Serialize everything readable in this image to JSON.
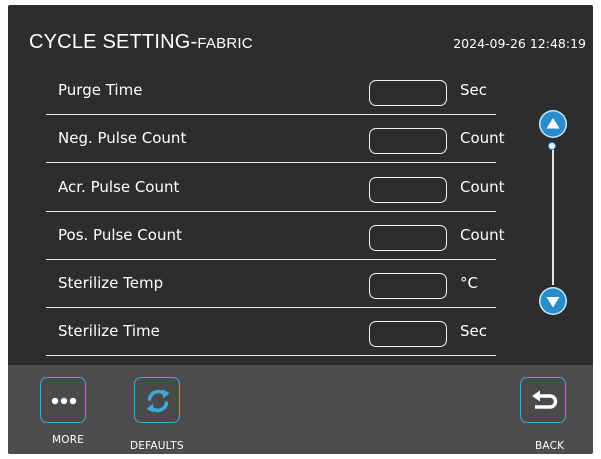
{
  "header": {
    "title_main": "CYCLE SETTING-",
    "title_small": "FABRIC",
    "datetime": "2024-09-26 12:48:19"
  },
  "settings": [
    {
      "label": "Purge Time",
      "value": "",
      "unit": "Sec"
    },
    {
      "label": "Neg. Pulse Count",
      "value": "",
      "unit": "Count"
    },
    {
      "label": "Acr. Pulse Count",
      "value": "",
      "unit": "Count"
    },
    {
      "label": "Pos. Pulse Count",
      "value": "",
      "unit": "Count"
    },
    {
      "label": "Sterilize Temp",
      "value": "",
      "unit": "°C"
    },
    {
      "label": "Sterilize Time",
      "value": "",
      "unit": "Sec"
    }
  ],
  "scrollbar": {
    "up_icon": "triangle-up-icon",
    "down_icon": "triangle-down-icon",
    "position_fraction": 0.0
  },
  "footer": {
    "more_label": "MORE",
    "defaults_label": "DEFAULTS",
    "back_label": "BACK",
    "more_icon": "ellipsis-icon",
    "defaults_icon": "refresh-icon",
    "back_icon": "return-arrow-icon"
  },
  "colors": {
    "background": "#2d2d2d",
    "footer": "#4d4d4d",
    "accent": "#3fa9d8",
    "scroll_button": "#2a8ccb",
    "text": "#ffffff"
  }
}
